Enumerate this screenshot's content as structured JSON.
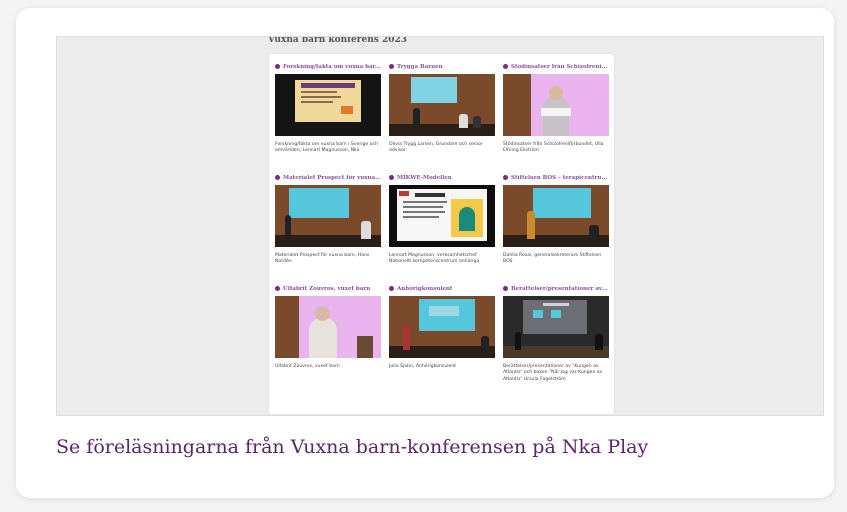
{
  "screenshot": {
    "title": "Vuxna barn konferens 2023",
    "tiles": [
      {
        "title": "Forskning/fakta om vuxna bar...",
        "description": "Forskning/fakta om vuxna barn i Sverige och omvärlden, Lennart Magnusson, Nka",
        "thumb": "slide-presentation"
      },
      {
        "title": "Trygga Barnen",
        "description": "Olivia Trygg Larsen, Grundare och senior advisor",
        "thumb": "lecture-hall"
      },
      {
        "title": "Stödinsatser från Schizofreni...",
        "description": "Stödinsatser från Schizofreniförbundet, Ulla Elfving Ekström",
        "thumb": "speaker-closeup"
      },
      {
        "title": "Materialet Prospect för vuxna ...",
        "description": "Materialet Prospect för vuxna barn, Hans Nordén",
        "thumb": "lecture-hall"
      },
      {
        "title": "MIKWE-Modellen",
        "description": "Lennart Magnusson, verksamhetschef Nationellt kompetenscentrum anhöriga",
        "thumb": "slide-presentation"
      },
      {
        "title": "Stiftelsen BOS – terapicentru...",
        "description": "Dahlia Rosai, generalsekreterare Stiftelsen BOS",
        "thumb": "lecture-hall"
      },
      {
        "title": "Ulfabrit Zouvros, vuxet barn",
        "description": "Ulfabrit Zouvros, vuxet barn",
        "thumb": "speaker-closeup"
      },
      {
        "title": "Anhörigkonsulent",
        "description": "Julia Sjahn, Anhörigkonsulent",
        "thumb": "lecture-hall"
      },
      {
        "title": "Berättelser/presentationer av \"...",
        "description": "Berättelser/presentationer av \"Kungen av Atlantis\" och boken \"När jag var Kungen av Atlantis\" Ursula Fogelström",
        "thumb": "dark-stage"
      }
    ]
  },
  "caption": "Se föreläsningarna från Vuxna barn-konferensen på Nka Play",
  "colors": {
    "accent": "#5b2768",
    "tile_title": "#8a4fa0",
    "dot": "#7a2a8a",
    "screen_cyan": "#55c6dc",
    "screen_pink": "#e6a8ea"
  }
}
